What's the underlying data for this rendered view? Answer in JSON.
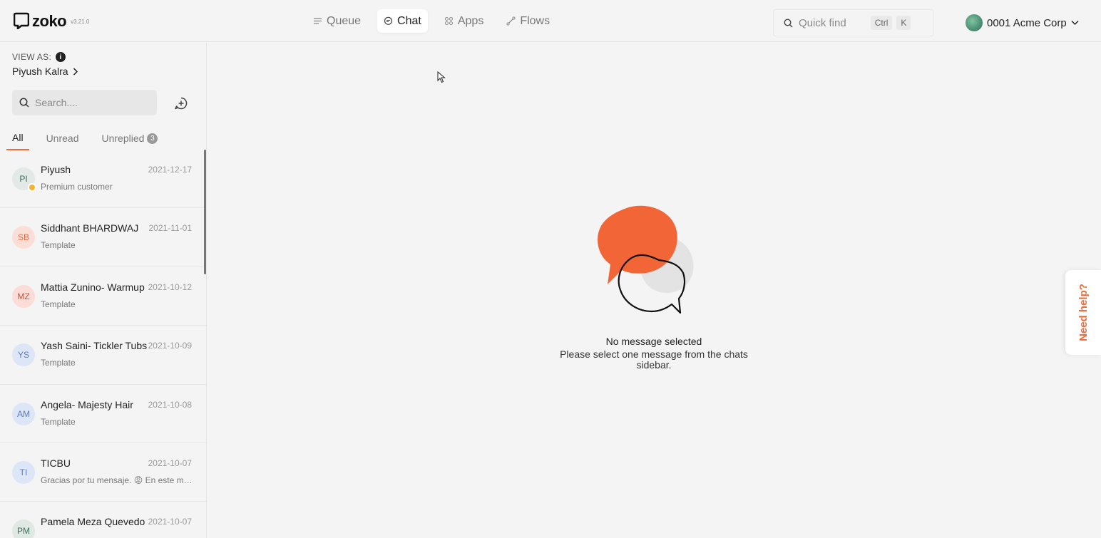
{
  "app": {
    "logo_text": "zoko",
    "version": "v3.21.0"
  },
  "nav": {
    "queue": "Queue",
    "chat": "Chat",
    "apps": "Apps",
    "flows": "Flows"
  },
  "quickfind": {
    "placeholder": "Quick find",
    "key1": "Ctrl",
    "key2": "K"
  },
  "org": {
    "name": "0001 Acme Corp"
  },
  "sidebar": {
    "view_as_label": "VIEW AS:",
    "viewer_name": "Piyush Kalra",
    "search_placeholder": "Search....",
    "tabs": [
      {
        "label": "All"
      },
      {
        "label": "Unread"
      },
      {
        "label": "Unreplied",
        "badge": "3"
      }
    ],
    "chats": [
      {
        "initials": "PI",
        "name": "Piyush",
        "date": "2021-12-17",
        "preview": "Premium customer",
        "avatar_bg": "#e3e9e6",
        "avatar_fg": "#3b6e58"
      },
      {
        "initials": "SB",
        "name": "Siddhant BHARDWAJ",
        "date": "2021-11-01",
        "preview": "Template",
        "avatar_bg": "#fbdfd6",
        "avatar_fg": "#e46a48"
      },
      {
        "initials": "MZ",
        "name": "Mattia Zunino- Warmup",
        "date": "2021-10-12",
        "preview": "Template",
        "avatar_bg": "#fbdcd6",
        "avatar_fg": "#c4553e"
      },
      {
        "initials": "YS",
        "name": "Yash Saini- Tickler Tubs",
        "date": "2021-10-09",
        "preview": "Template",
        "avatar_bg": "#dde6f6",
        "avatar_fg": "#5b7cc0"
      },
      {
        "initials": "AM",
        "name": "Angela- Majesty Hair",
        "date": "2021-10-08",
        "preview": "Template",
        "avatar_bg": "#dde6f6",
        "avatar_fg": "#5b7cc0"
      },
      {
        "initials": "TI",
        "name": "TICBU",
        "date": "2021-10-07",
        "preview": "Gracias por tu mensaje. 😡 En este momento",
        "avatar_bg": "#dde6f6",
        "avatar_fg": "#5b7cc0"
      },
      {
        "initials": "PM",
        "name": "Pamela Meza Quevedo",
        "date": "2021-10-07",
        "preview": "",
        "avatar_bg": "#dfe8e2",
        "avatar_fg": "#3b6e58"
      }
    ]
  },
  "empty_state": {
    "title": "No message selected",
    "subtitle": "Please select one message from the chats sidebar."
  },
  "help": {
    "label": "Need help?"
  },
  "colors": {
    "accent": "#f06a3a",
    "bubble_orange": "#f26536"
  }
}
